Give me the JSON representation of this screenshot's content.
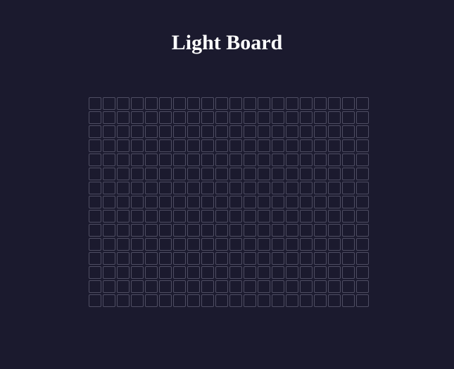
{
  "page": {
    "title": "Light Board"
  },
  "board": {
    "columns": 20,
    "rows": 15,
    "lit_cells": [],
    "colors": {
      "background": "#1b1a2e",
      "cell_border": "#4f4e63",
      "cell_off": "#1b1a2e",
      "cell_on": "#f5e663"
    }
  }
}
